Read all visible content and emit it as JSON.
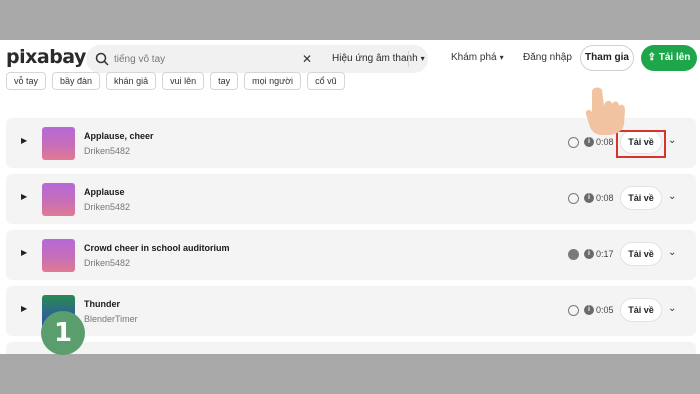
{
  "header": {
    "logo": "pixabay",
    "search": {
      "placeholder": "tiếng vỗ tay",
      "clear_icon": "close-icon",
      "filter_label": "Hiệu ứng âm thanh"
    },
    "nav_explore": "Khám phá",
    "nav_login": "Đăng nhập",
    "join_label": "Tham gia",
    "upload_label": "Tải lên"
  },
  "tags": [
    "vỗ tay",
    "bầy đàn",
    "khán giả",
    "vui lên",
    "tay",
    "mọi người",
    "cổ vũ"
  ],
  "tracks": [
    {
      "title": "Applause, cheer",
      "author": "Driken5482",
      "duration": "0:08",
      "download": "Tải về",
      "icon": "check-icon"
    },
    {
      "title": "Applause",
      "author": "Driken5482",
      "duration": "0:08",
      "download": "Tải về",
      "icon": "check-icon"
    },
    {
      "title": "Crowd cheer in school auditorium",
      "author": "Driken5482",
      "duration": "0:17",
      "download": "Tải về",
      "icon": "star-icon"
    },
    {
      "title": "Thunder",
      "author": "BlenderTimer",
      "duration": "0:05",
      "download": "Tải về",
      "icon": "check-icon"
    }
  ],
  "step_badge": "1",
  "colors": {
    "accent_green": "#1ea74a",
    "highlight_red": "#d9342b",
    "badge_green": "#5b9e6e"
  }
}
